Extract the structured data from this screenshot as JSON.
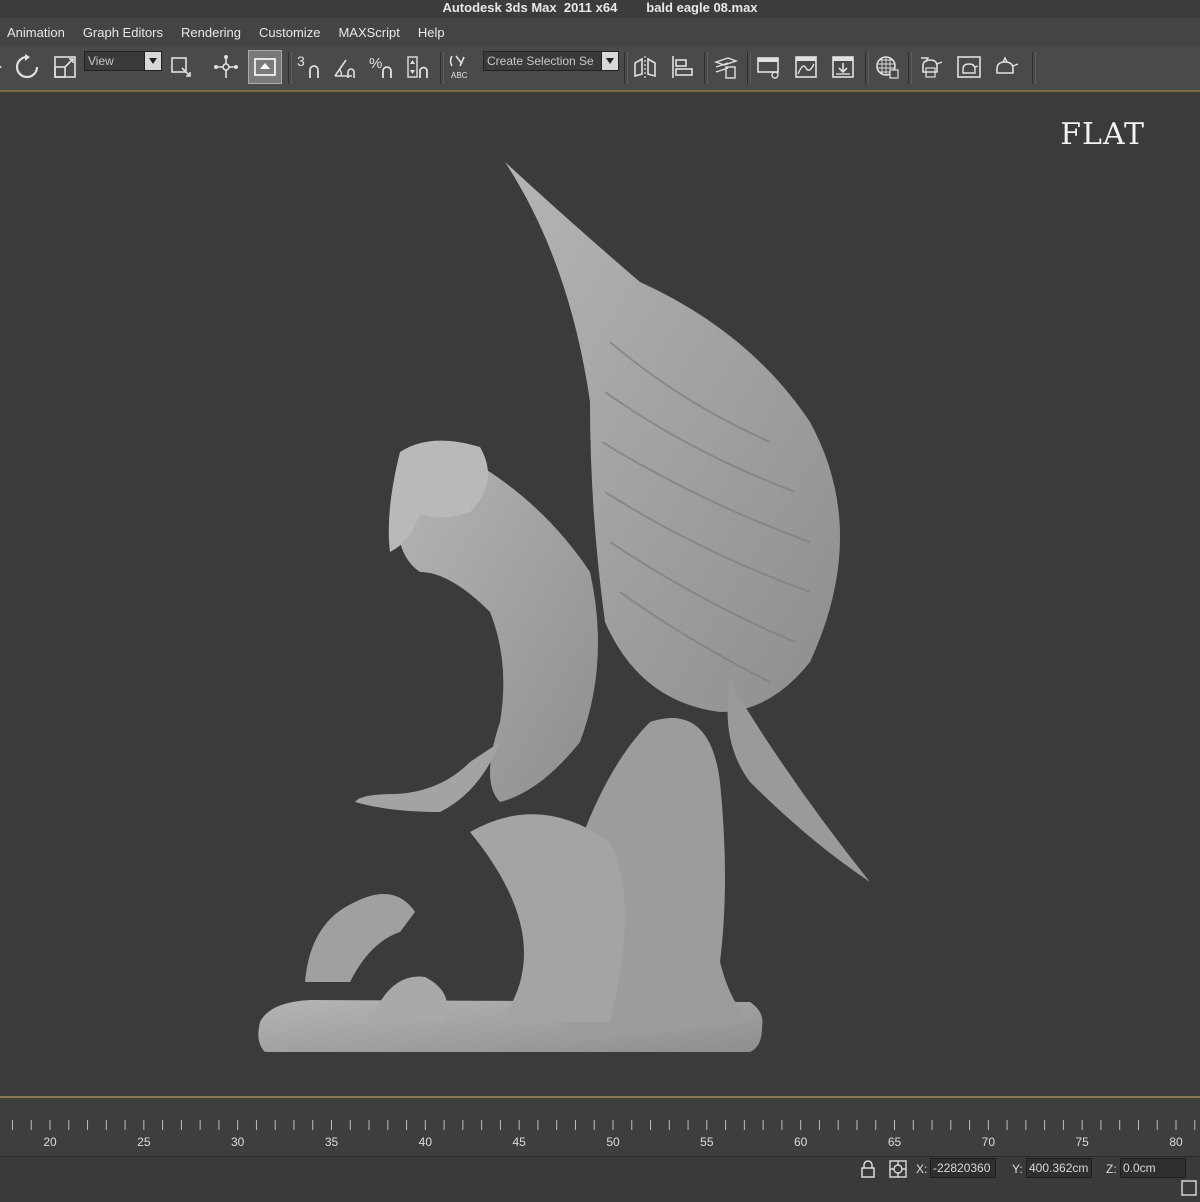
{
  "window": {
    "app_title": "Autodesk 3ds Max  2011 x64",
    "file_name": "bald eagle 08.max"
  },
  "menu": {
    "items": [
      "Animation",
      "Graph Editors",
      "Rendering",
      "Customize",
      "MAXScript",
      "Help"
    ]
  },
  "toolbar": {
    "reference_coord_value": "View",
    "selection_set_placeholder": "Create Selection Se",
    "snap_label": "3",
    "angle_snap_label": "%",
    "icons": [
      "select-arrow-icon",
      "rotate-icon",
      "scale-icon",
      "pivot-icon",
      "select-manipulate-icon",
      "keyboard-shortcut-icon",
      "snap-toggle-icon",
      "angle-snap-icon",
      "percent-snap-icon",
      "spinner-snap-icon",
      "edit-named-selection-icon",
      "mirror-icon",
      "align-icon",
      "layer-manager-icon",
      "graphite-toggle-icon",
      "curve-editor-icon",
      "schematic-view-icon",
      "material-editor-icon",
      "render-setup-icon",
      "rendered-frame-icon",
      "render-production-icon"
    ]
  },
  "viewport": {
    "label": "FLAT",
    "subject": "eagle sculpture"
  },
  "timeline": {
    "ticks": [
      "20",
      "25",
      "30",
      "35",
      "40",
      "45",
      "50",
      "55",
      "60",
      "65",
      "70",
      "75",
      "80"
    ]
  },
  "status": {
    "x_label": "X:",
    "x_value": "-22820360",
    "y_label": "Y:",
    "y_value": "400.362cm",
    "z_label": "Z:",
    "z_value": "0.0cm"
  },
  "colors": {
    "accent": "#8a7a4a",
    "viewport_bg": "#3b3b3b",
    "model": "#a8a8a8"
  }
}
